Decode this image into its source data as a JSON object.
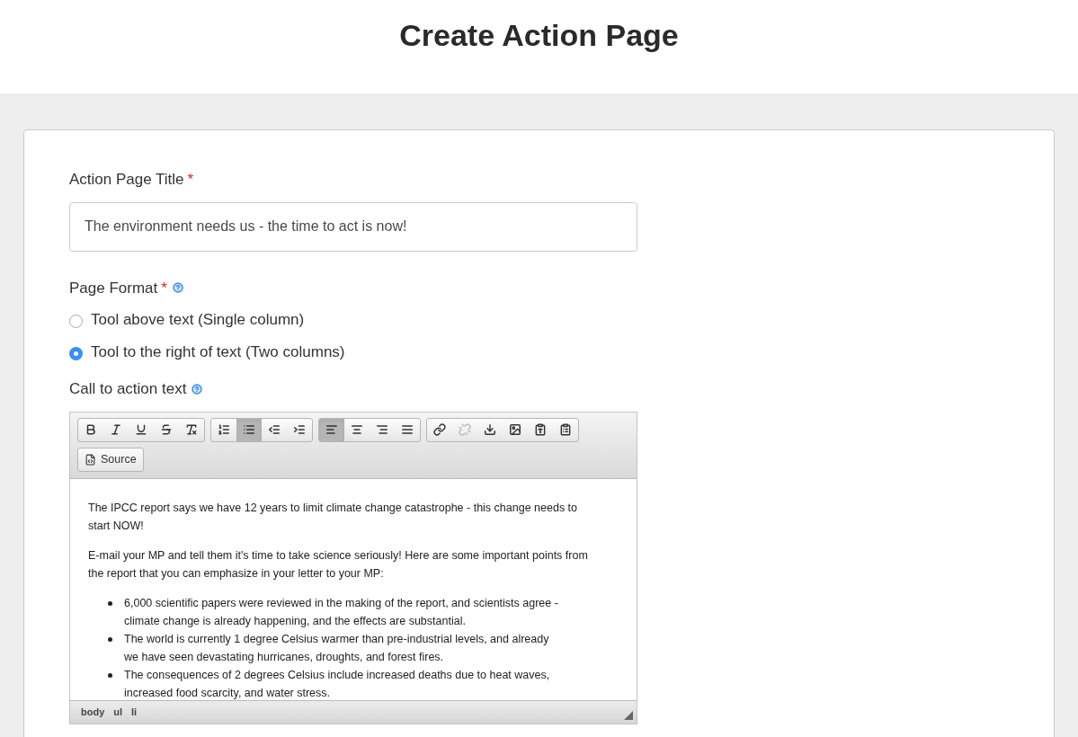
{
  "header": {
    "title": "Create Action Page"
  },
  "title_field": {
    "label": "Action Page Title",
    "required_mark": "*",
    "value": "The environment needs us - the time to act is now!"
  },
  "page_format": {
    "label": "Page Format",
    "required_mark": "*",
    "help": true,
    "options": [
      {
        "label": "Tool above text (Single column)",
        "selected": false
      },
      {
        "label": "Tool to the right of text (Two columns)",
        "selected": true
      }
    ]
  },
  "cta": {
    "label": "Call to action text",
    "help": true,
    "toolbar": [
      [
        {
          "kind": "bold",
          "selected": false,
          "disabled": false
        },
        {
          "kind": "italic",
          "selected": false,
          "disabled": false
        },
        {
          "kind": "underline",
          "selected": false,
          "disabled": false
        },
        {
          "kind": "strike",
          "selected": false,
          "disabled": false
        },
        {
          "kind": "clear-format",
          "selected": false,
          "disabled": false
        }
      ],
      [
        {
          "kind": "numbered-list",
          "selected": false,
          "disabled": false
        },
        {
          "kind": "bulleted-list",
          "selected": true,
          "disabled": false
        },
        {
          "kind": "outdent",
          "selected": false,
          "disabled": false
        },
        {
          "kind": "indent",
          "selected": false,
          "disabled": false
        }
      ],
      [
        {
          "kind": "align-left",
          "selected": true,
          "disabled": false
        },
        {
          "kind": "align-center",
          "selected": false,
          "disabled": false
        },
        {
          "kind": "align-right",
          "selected": false,
          "disabled": false
        },
        {
          "kind": "justify",
          "selected": false,
          "disabled": false
        }
      ],
      [
        {
          "kind": "link",
          "selected": false,
          "disabled": false
        },
        {
          "kind": "unlink",
          "selected": false,
          "disabled": true
        },
        {
          "kind": "anchor",
          "selected": false,
          "disabled": false
        },
        {
          "kind": "image",
          "selected": false,
          "disabled": false
        },
        {
          "kind": "paste-text",
          "selected": false,
          "disabled": false
        },
        {
          "kind": "paste-word",
          "selected": false,
          "disabled": false
        }
      ]
    ],
    "source_button": "Source",
    "content": [
      {
        "kind": "paragraph",
        "text": "The IPCC report says we have 12 years to limit climate change catastrophe - this change needs to start NOW!"
      },
      {
        "kind": "paragraph",
        "text": "E-mail your MP and tell them it's time to take science seriously! Here are some important points from the report that you can emphasize in your letter to your MP:"
      },
      {
        "kind": "bullets",
        "items": [
          "6,000 scientific papers were reviewed in the making of the report, and scientists agree - climate change is already happening, and the effects are substantial.",
          "The world is currently 1 degree Celsius warmer than pre-industrial levels, and already we have seen devastating hurricanes, droughts, and forest fires.",
          "The consequences of 2 degrees Celsius include increased deaths due to heat waves, increased food scarcity, and water stress."
        ]
      }
    ],
    "path": [
      "body",
      "ul",
      "li"
    ]
  }
}
